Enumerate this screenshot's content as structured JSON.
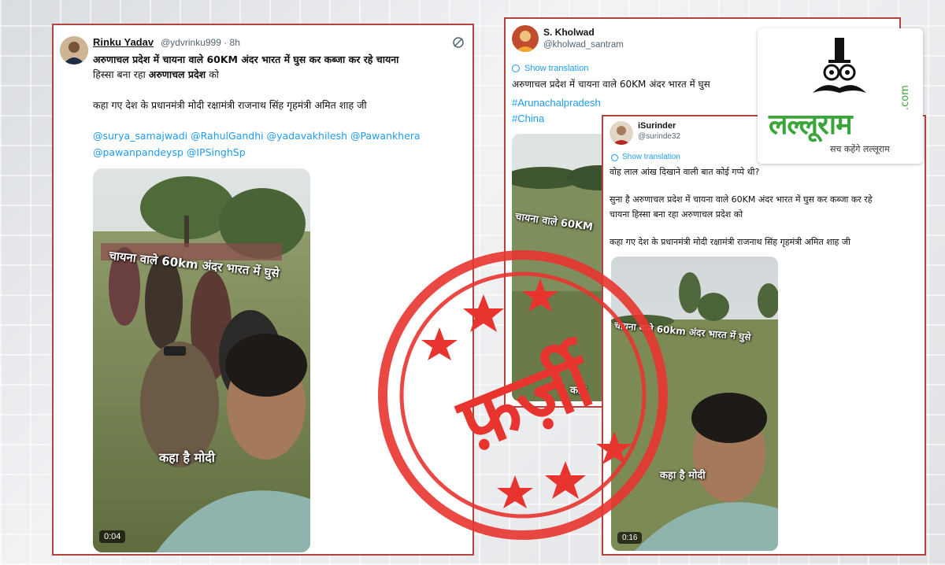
{
  "colors": {
    "stamp": "#e8342f",
    "card_border": "#b0453f",
    "link": "#1d9bf0",
    "logo_green": "#3aa63a"
  },
  "tweet1": {
    "name": "Rinku Yadav",
    "handle": "@ydvrinku999 · 8h",
    "icon": "grok-icon",
    "line1": "अरुणाचल प्रदेश में चायना वाले 60KM अंदर भारत में घुस कर कब्जा कर रहे चायना",
    "line2_a": "हिस्सा बना रहा ",
    "line2_b": "अरुणाचल प्रदेश",
    "line2_c": " को",
    "line3": "कहा गए देश के प्रधानमंत्री मोदी रक्षामंत्री राजनाथ सिंह गृहमंत्री अमित शाह जी",
    "mentions1": "@surya_samajwadi @RahulGandhi @yadavakhilesh @Pawankhera",
    "mentions2": "@pawanpandeysp @IPSinghSp",
    "video": {
      "overlay1": "चायना वाले 60km अंदर भारत में घुसे",
      "overlay2": "कहा है मोदी",
      "duration": "0:04"
    }
  },
  "tweet2": {
    "name": "S. Kholwad",
    "handle": "@kholwad_santram",
    "show_translation": "Show translation",
    "text": "अरुणाचल प्रदेश में चायना वाले 60KM अंदर भारत में घुस",
    "hashtag1": "#Arunachalpradesh",
    "hashtag2": "#China",
    "video": {
      "overlay1": "चायना वाले 60KM",
      "overlay2": "कहा"
    }
  },
  "tweet3": {
    "name": "iSurinder",
    "handle": "@surinde32",
    "show_translation": "Show translation",
    "line1": "वोह लाल आंख दिखाने वाली बात कोई गप्पे थी?",
    "line2": "सुना है अरुणाचल प्रदेश में चायना वाले 60KM अंदर भारत में घुस कर कब्जा कर रहे",
    "line3": "चायना हिस्सा बना रहा अरुणाचल प्रदेश को",
    "line4": "कहा गए देश के प्रधानमंत्री मोदी रक्षामंत्री राजनाथ सिंह गृहमंत्री अमित शाह जी",
    "video": {
      "overlay1": "चायना वाले 60km अंदर भारत में घुसे",
      "overlay2": "कहा है मोदी",
      "duration": "0:16"
    }
  },
  "stamp": {
    "text": "फ़र्ज़ी"
  },
  "logo": {
    "brand": "लल्लूराम",
    "dotcom": ".com",
    "tagline": "सच कहेंगे लल्लूराम"
  }
}
